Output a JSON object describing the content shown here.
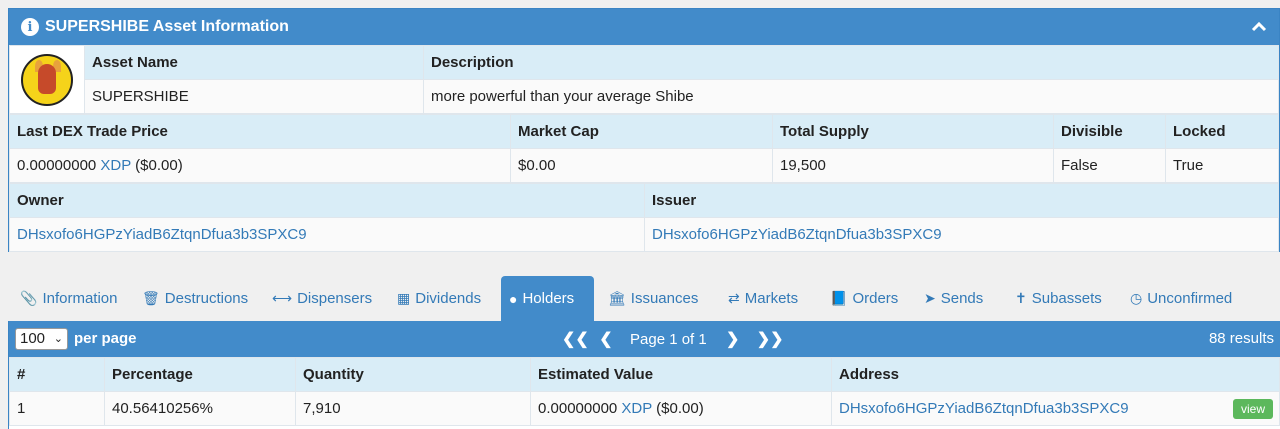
{
  "panel": {
    "title": "SUPERSHIBE Asset Information"
  },
  "asset": {
    "name_header": "Asset Name",
    "desc_header": "Description",
    "name": "SUPERSHIBE",
    "description": "more powerful than your average Shibe"
  },
  "stats": {
    "headers": [
      "Last DEX Trade Price",
      "Market Cap",
      "Total Supply",
      "Divisible",
      "Locked"
    ],
    "price_value": "0.00000000",
    "price_unit": "XDP",
    "price_usd": "($0.00)",
    "market_cap": "$0.00",
    "total_supply": "19,500",
    "divisible": "False",
    "locked": "True"
  },
  "parties": {
    "owner_header": "Owner",
    "issuer_header": "Issuer",
    "owner": "DHsxofo6HGPzYiadB6ZtqnDfua3b3SPXC9",
    "issuer": "DHsxofo6HGPzYiadB6ZtqnDfua3b3SPXC9"
  },
  "tabs": [
    {
      "label": "Information",
      "icon": "paperclip-icon"
    },
    {
      "label": "Destructions",
      "icon": "trash-icon"
    },
    {
      "label": "Dispensers",
      "icon": "arrows-h-icon"
    },
    {
      "label": "Dividends",
      "icon": "sitemap-icon"
    },
    {
      "label": "Holders",
      "icon": "user-icon"
    },
    {
      "label": "Issuances",
      "icon": "bank-icon"
    },
    {
      "label": "Markets",
      "icon": "exchange-icon"
    },
    {
      "label": "Orders",
      "icon": "book-icon"
    },
    {
      "label": "Sends",
      "icon": "paper-plane-icon"
    },
    {
      "label": "Subassets",
      "icon": "child-icon"
    },
    {
      "label": "Unconfirmed",
      "icon": "clock-icon"
    }
  ],
  "grid": {
    "per_page_value": "100",
    "per_page_label": "per page",
    "page_text": "Page 1 of 1",
    "results": "88 results",
    "columns": [
      "#",
      "Percentage",
      "Quantity",
      "Estimated Value",
      "Address"
    ],
    "rows": [
      {
        "index": "1",
        "percentage": "40.56410256%",
        "quantity": "7,910",
        "value_amount": "0.00000000",
        "value_unit": "XDP",
        "value_usd": "($0.00)",
        "address": "DHsxofo6HGPzYiadB6ZtqnDfua3b3SPXC9",
        "action": "view"
      }
    ]
  },
  "colors": {
    "accent": "#428bca",
    "header_cell": "#d9edf7",
    "link": "#337ab7",
    "view_button": "#5cb85c"
  }
}
